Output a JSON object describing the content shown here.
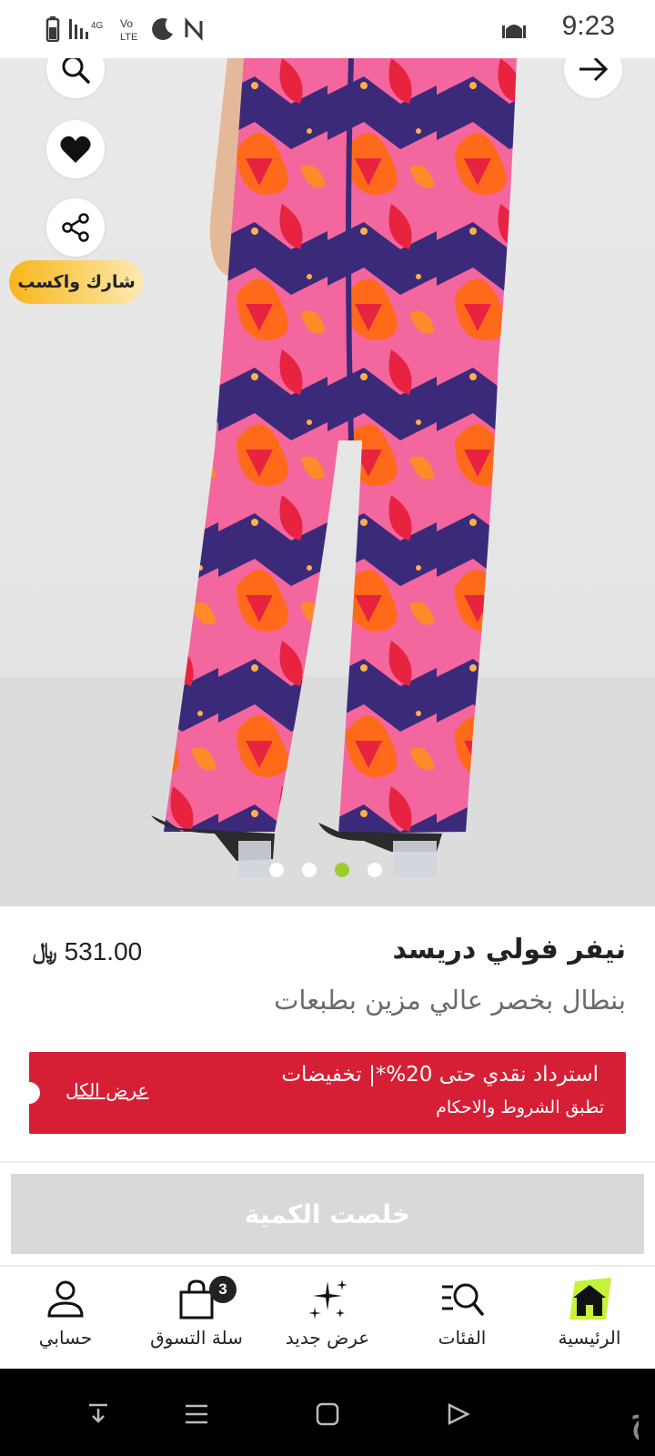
{
  "status_bar": {
    "time": "9:23",
    "icons": [
      "battery-icon",
      "signal-icon",
      "volte-icon",
      "moon-icon",
      "nfc-icon",
      "mosque-icon"
    ],
    "network_label": "4G",
    "volte_label": "Vo LTE"
  },
  "product": {
    "brand": "نيفر فولي دريسد",
    "title": "بنطال بخصر عالي مزين بطبعات",
    "price": "531.00",
    "currency_symbol": "﷼",
    "share_earn_label": "شارك واكسب",
    "image_count": 4,
    "active_image_index": 2
  },
  "promo": {
    "title": "استرداد نقدي حتى 20%*| تخفيضات",
    "subtitle": "تطبق الشروط والاحكام",
    "link_label": "عرض الكل",
    "color": "#d61f35"
  },
  "sold_out_label": "خلصت الكمية",
  "bottom_nav": {
    "items": [
      {
        "label": "الرئيسية",
        "icon": "home-icon"
      },
      {
        "label": "الفئات",
        "icon": "categories-search-icon"
      },
      {
        "label": "عرض جديد",
        "icon": "sparkles-icon"
      },
      {
        "label": "سلة التسوق",
        "icon": "shopping-bag-icon",
        "badge": "3"
      },
      {
        "label": "حسابي",
        "icon": "profile-icon"
      }
    ],
    "accent": "#c6f23a"
  },
  "system_nav": {
    "icons": [
      "download-icon",
      "menu-icon",
      "home-square-icon",
      "back-icon"
    ],
    "watermark_text": "حراج"
  }
}
